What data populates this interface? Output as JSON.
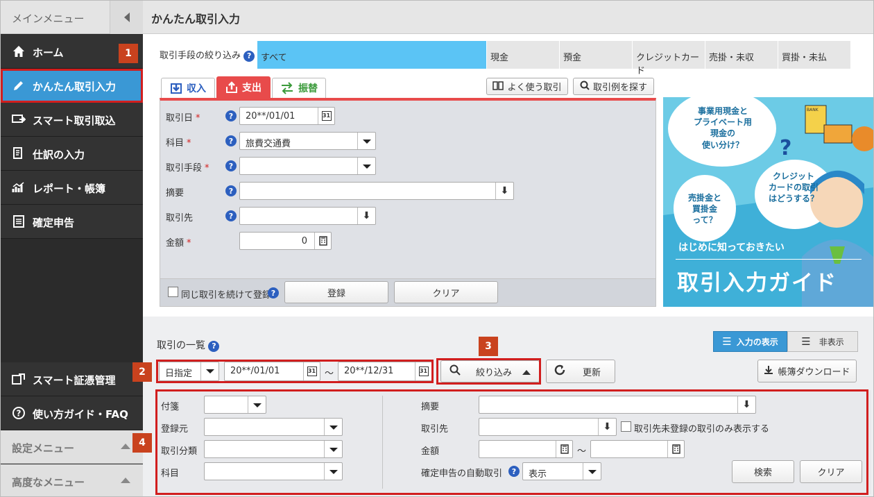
{
  "sidebar": {
    "title": "メインメニュー",
    "items": [
      "ホーム",
      "かんたん取引入力",
      "スマート取引取込",
      "仕訳の入力",
      "レポート・帳簿",
      "確定申告"
    ],
    "bottom_items": [
      "スマート証憑管理",
      "使い方ガイド・FAQ"
    ],
    "submenus": [
      "設定メニュー",
      "高度なメニュー"
    ]
  },
  "badges": [
    "1",
    "2",
    "3",
    "4"
  ],
  "page_title": "かんたん取引入力",
  "filter": {
    "label": "取引手段の絞り込み",
    "help": "?",
    "tabs": [
      "すべて",
      "現金",
      "預金",
      "クレジットカード",
      "売掛・未収",
      "買掛・未払"
    ]
  },
  "tabs": {
    "income": "収入",
    "expense": "支出",
    "transfer": "振替"
  },
  "tools": {
    "frequent": "よく使う取引",
    "search_example": "取引例を探す"
  },
  "form": {
    "date_label": "取引日",
    "date_value": "20**/01/01",
    "account_label": "科目",
    "account_value": "旅費交通費",
    "method_label": "取引手段",
    "memo_label": "摘要",
    "partner_label": "取引先",
    "amount_label": "金額",
    "amount_value": "0",
    "req": "*",
    "cal": "31",
    "help": "?",
    "repeat_label": "同じ取引を続けて登録",
    "register": "登録",
    "clear": "クリア"
  },
  "banner": {
    "bubble1": "事業用現金と\nプライベート用\n現金の\n使い分け？",
    "bubble2": "クレジット\nカードの取引\nはどうする？",
    "bubble3": "売掛金と\n買掛金\nって？",
    "qmark": "?",
    "bank": "BANK",
    "sub": "はじめに知っておきたい",
    "title": "取引入力ガイド"
  },
  "list": {
    "title": "取引の一覧",
    "help": "?",
    "show_input": "入力の表示",
    "hide": "非表示",
    "date_mode": "日指定",
    "date_from": "20**/01/01",
    "tilde": "〜",
    "date_to": "20**/12/31",
    "cal": "31",
    "filter_btn": "絞り込み",
    "refresh": "更新",
    "download": "帳簿ダウンロード"
  },
  "search": {
    "sticky": "付箋",
    "source": "登録元",
    "category": "取引分類",
    "account": "科目",
    "memo": "摘要",
    "partner": "取引先",
    "partner_check": "取引先未登録の取引のみ表示する",
    "amount": "金額",
    "tilde": "〜",
    "auto_label": "確定申告の自動取引",
    "help": "?",
    "auto_value": "表示",
    "search_btn": "検索",
    "clear_btn": "クリア"
  },
  "colors": {
    "accent": "#3a98d5",
    "expense": "#e84b4b",
    "income": "#2c5fbf",
    "transfer": "#3a9a3a",
    "badge": "#c9421e",
    "highlight": "#d11e1e",
    "filter_active": "#5bc4f5"
  }
}
